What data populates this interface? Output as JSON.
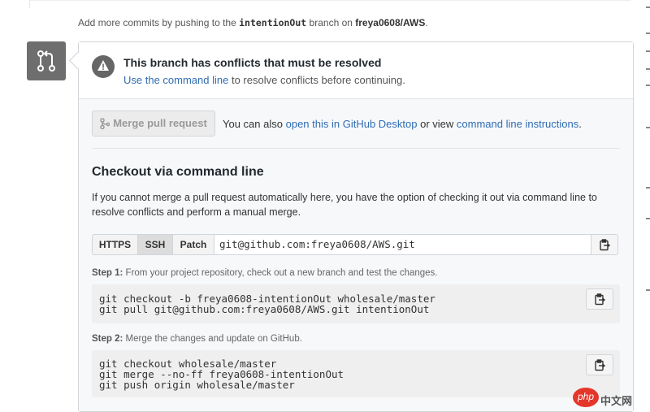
{
  "push_note": {
    "prefix": "Add more commits by pushing to the",
    "branch": "intentionOut",
    "middle": "branch on",
    "repo": "freya0608/AWS",
    "suffix": "."
  },
  "conflict": {
    "title": "This branch has conflicts that must be resolved",
    "link": "Use the command line",
    "rest": "to resolve conflicts before continuing."
  },
  "merge": {
    "button_label": "Merge pull request",
    "alt_prefix": "You can also",
    "desktop_link": "open this in GitHub Desktop",
    "alt_middle": "or view",
    "instructions_link": "command line instructions",
    "alt_suffix": "."
  },
  "checkout": {
    "title": "Checkout via command line",
    "description": "If you cannot merge a pull request automatically here, you have the option of checking it out via command line to resolve conflicts and perform a manual merge.",
    "protocols": [
      "HTTPS",
      "SSH",
      "Patch"
    ],
    "selected_protocol": "SSH",
    "clone_url": "git@github.com:freya0608/AWS.git"
  },
  "steps": [
    {
      "label": "Step 1:",
      "text": "From your project repository, check out a new branch and test the changes.",
      "code": "git checkout -b freya0608-intentionOut wholesale/master\ngit pull git@github.com:freya0608/AWS.git intentionOut"
    },
    {
      "label": "Step 2:",
      "text": "Merge the changes and update on GitHub.",
      "code": "git checkout wholesale/master\ngit merge --no-ff freya0608-intentionOut\ngit push origin wholesale/master"
    }
  ],
  "watermark": {
    "logo": "php",
    "text": "中文网"
  },
  "colors": {
    "link": "#2f6db4",
    "icon_bg": "#6e6e6e",
    "code_bg": "#efefef"
  },
  "icons": [
    "git-pull-request-icon",
    "alert-icon",
    "git-merge-icon",
    "clipboard-icon"
  ]
}
